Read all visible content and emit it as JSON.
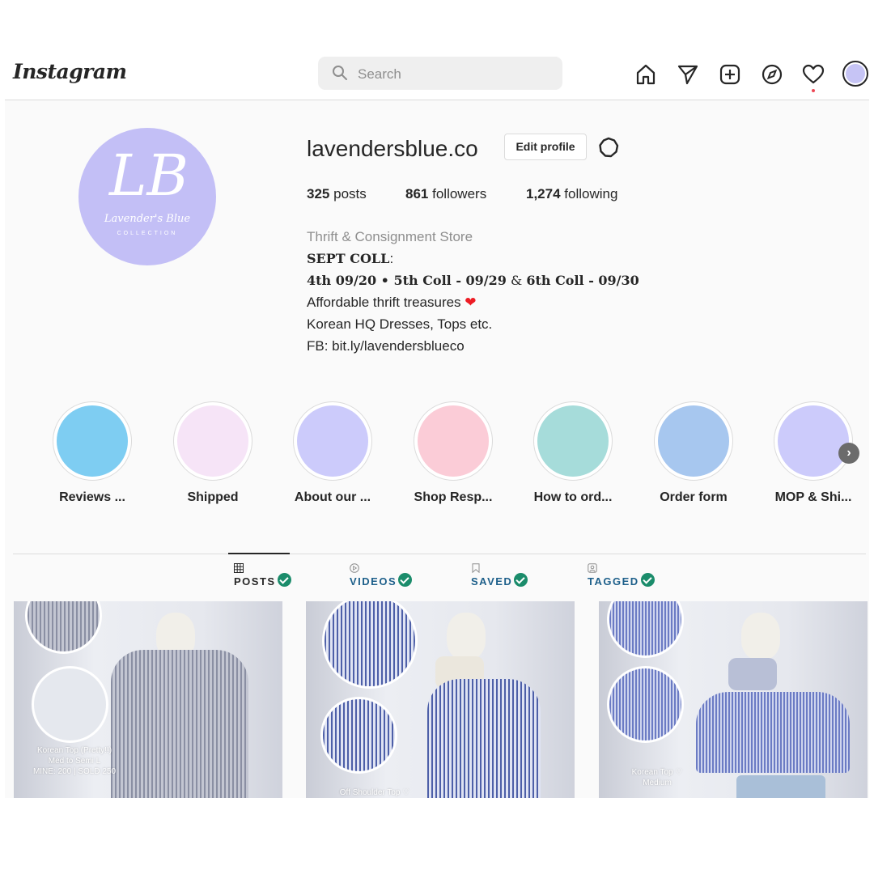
{
  "nav": {
    "logo": "Instagram",
    "search_placeholder": "Search",
    "icons": [
      "home-icon",
      "direct-message-icon",
      "new-post-icon",
      "explore-icon",
      "activity-heart-icon",
      "profile-avatar"
    ]
  },
  "profile": {
    "username": "lavendersblue.co",
    "edit_label": "Edit profile",
    "avatar_monogram": "LB",
    "avatar_brand": "Lavender's Blue",
    "avatar_sub": "COLLECTION",
    "stats": {
      "posts_count": "325",
      "posts_label": "posts",
      "followers_count": "861",
      "followers_label": "followers",
      "following_count": "1,274",
      "following_label": "following"
    },
    "bio": {
      "category": "Thrift & Consignment Store",
      "line1_bold": "SEPT COLL",
      "line1_rest": ":",
      "line2_a": "4th 09/20 • 5th Coll - 09/29",
      "line2_amp": " & ",
      "line2_b": "6th Coll - 09/30",
      "line3": "Affordable thrift treasures",
      "line3_emoji": "❤",
      "line4": "Korean HQ Dresses, Tops etc.",
      "line5": "FB: bit.ly/lavendersblueco"
    }
  },
  "highlights": [
    {
      "label": "Reviews ...",
      "color": "#7ecdf2"
    },
    {
      "label": "Shipped",
      "color": "#f6e4f7"
    },
    {
      "label": "About our ...",
      "color": "#cccbfb"
    },
    {
      "label": "Shop Resp...",
      "color": "#fbccd7"
    },
    {
      "label": "How to ord...",
      "color": "#a6dcda"
    },
    {
      "label": "Order form",
      "color": "#a7c7ef"
    },
    {
      "label": "MOP & Shi...",
      "color": "#cccbfb"
    }
  ],
  "tabs": [
    {
      "label": "POSTS"
    },
    {
      "label": "VIDEOS"
    },
    {
      "label": "SAVED"
    },
    {
      "label": "TAGGED"
    }
  ],
  "posts": [
    {
      "caption1": "Korean Top (Pretty!!)",
      "caption2": "Med to Semi L",
      "caption3": "MINE: 200 | SOLD 250"
    },
    {
      "caption1": "Off Shoulder Top ♡"
    },
    {
      "caption1": "Korean Top ♡",
      "caption2": "Medium"
    }
  ],
  "colors": {
    "accent_check": "#1b8c6b",
    "avatar_lavender": "#c3bff6",
    "notification_dot": "#ed4956"
  }
}
